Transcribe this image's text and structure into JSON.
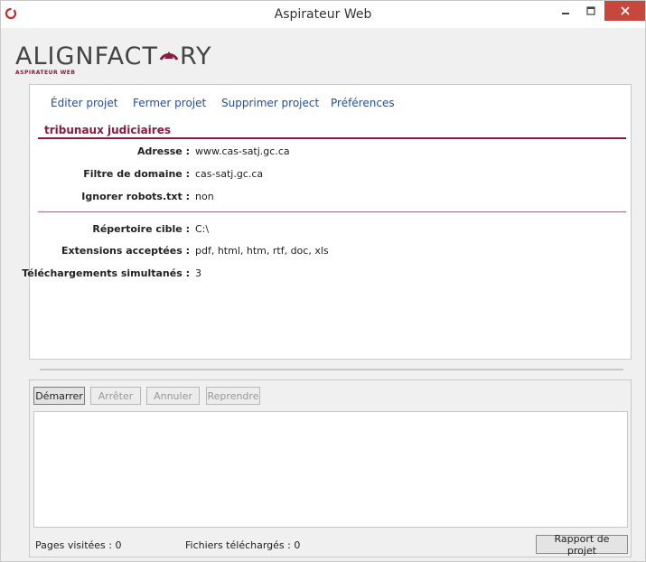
{
  "window": {
    "title": "Aspirateur Web"
  },
  "logo": {
    "text_before": "ALIGNFACT",
    "text_after": "RY",
    "subtitle": "ASPIRATEUR WEB",
    "accent": "#8b1a3c"
  },
  "menu": [
    {
      "label": "Éditer projet"
    },
    {
      "label": "Fermer projet"
    },
    {
      "label": "Supprimer project"
    },
    {
      "label": "Préférences"
    }
  ],
  "project": {
    "name": "tribunaux judiciaires",
    "fields": [
      {
        "label": "Adresse :",
        "value": "www.cas-satj.gc.ca"
      },
      {
        "label": "Filtre de domaine :",
        "value": "cas-satj.gc.ca"
      },
      {
        "label": "Ignorer robots.txt :",
        "value": "non"
      },
      {
        "label": "Répertoire cible :",
        "value": "C:\\"
      },
      {
        "label": "Extensions acceptées :",
        "value": "pdf, html, htm, rtf, doc, xls"
      },
      {
        "label": "Téléchargements simultanés :",
        "value": "3"
      }
    ]
  },
  "controls": {
    "start": "Démarrer",
    "stop": "Arrêter",
    "cancel": "Annuler",
    "resume": "Reprendre"
  },
  "status": {
    "pages_visited": "Pages visitées : 0",
    "files_downloaded": "Fichiers téléchargés : 0",
    "report_button": "Rapport de projet"
  },
  "icons": {
    "app": "alignfactory-o-icon",
    "minimize": "minimize-icon",
    "maximize": "maximize-icon",
    "close": "close-icon"
  },
  "colors": {
    "link": "#1a4fb8",
    "close": "#c7473d"
  }
}
